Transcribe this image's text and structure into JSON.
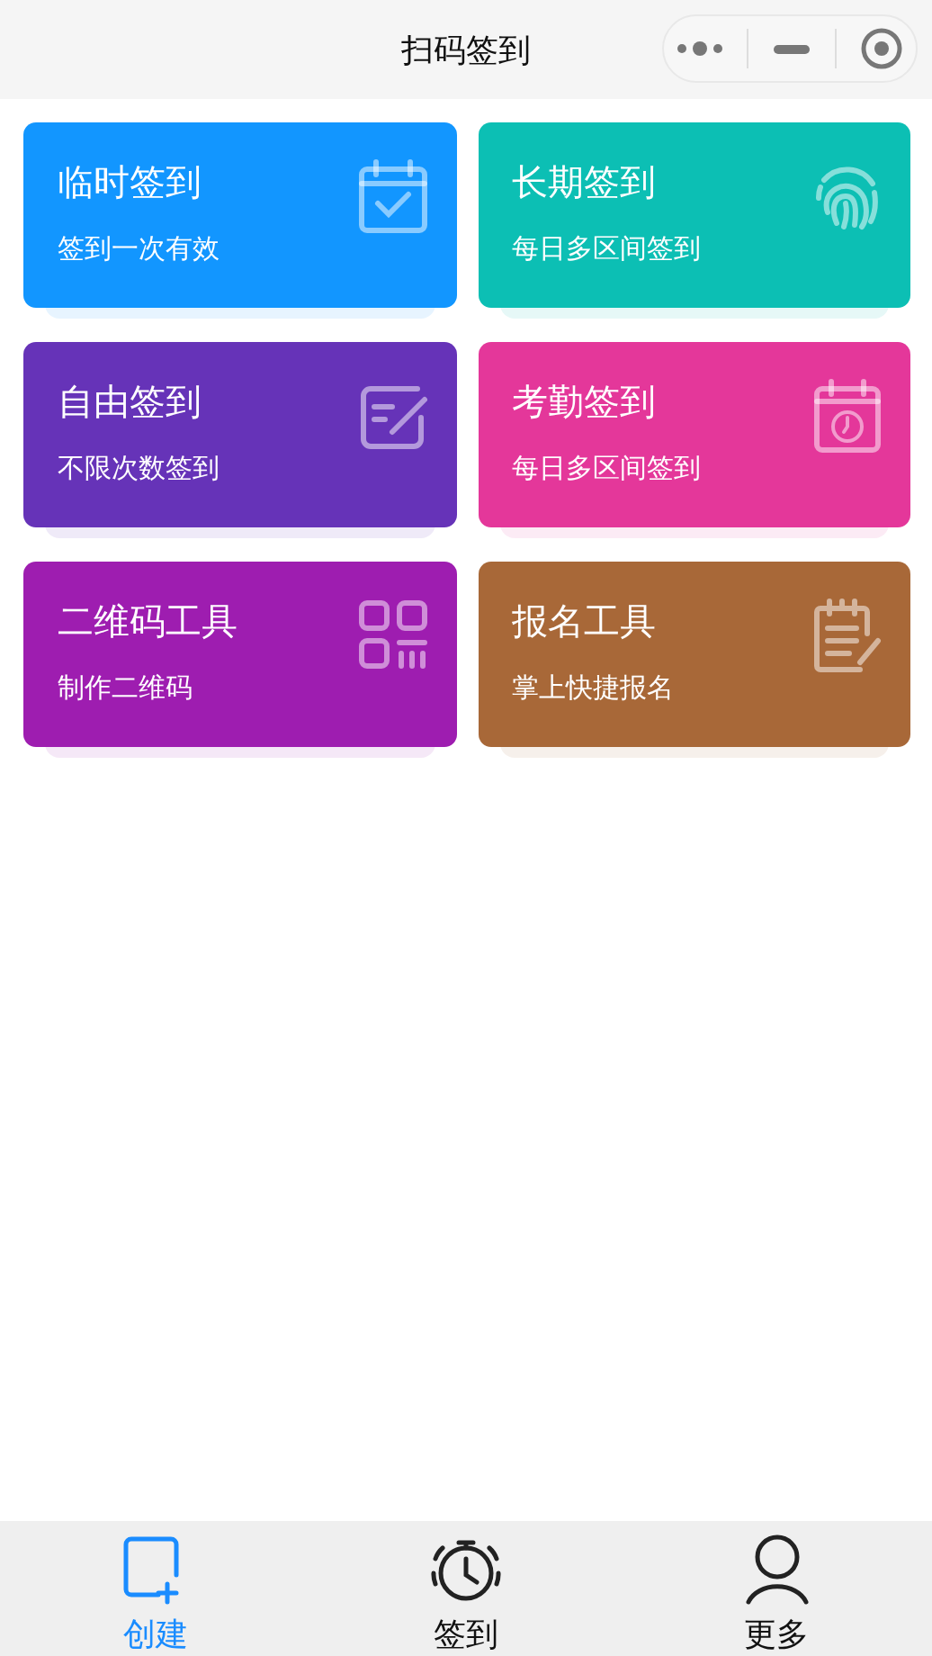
{
  "header": {
    "title": "扫码签到"
  },
  "cards": [
    {
      "title": "临时签到",
      "subtitle": "签到一次有效",
      "color": "#1296ff",
      "kind": "calendar-check"
    },
    {
      "title": "长期签到",
      "subtitle": "每日多区间签到",
      "color": "#0cbfb4",
      "kind": "fingerprint"
    },
    {
      "title": "自由签到",
      "subtitle": "不限次数签到",
      "color": "#6633b8",
      "kind": "edit"
    },
    {
      "title": "考勤签到",
      "subtitle": "每日多区间签到",
      "color": "#e4379a",
      "kind": "calendar-clock"
    },
    {
      "title": "二维码工具",
      "subtitle": "制作二维码",
      "color": "#9e1db0",
      "kind": "qrcode"
    },
    {
      "title": "报名工具",
      "subtitle": "掌上快捷报名",
      "color": "#a86838",
      "kind": "clipboard"
    }
  ],
  "tabs": [
    {
      "label": "创建",
      "selected": true,
      "kind": "create"
    },
    {
      "label": "签到",
      "selected": false,
      "kind": "alarm"
    },
    {
      "label": "更多",
      "selected": false,
      "kind": "user"
    }
  ]
}
